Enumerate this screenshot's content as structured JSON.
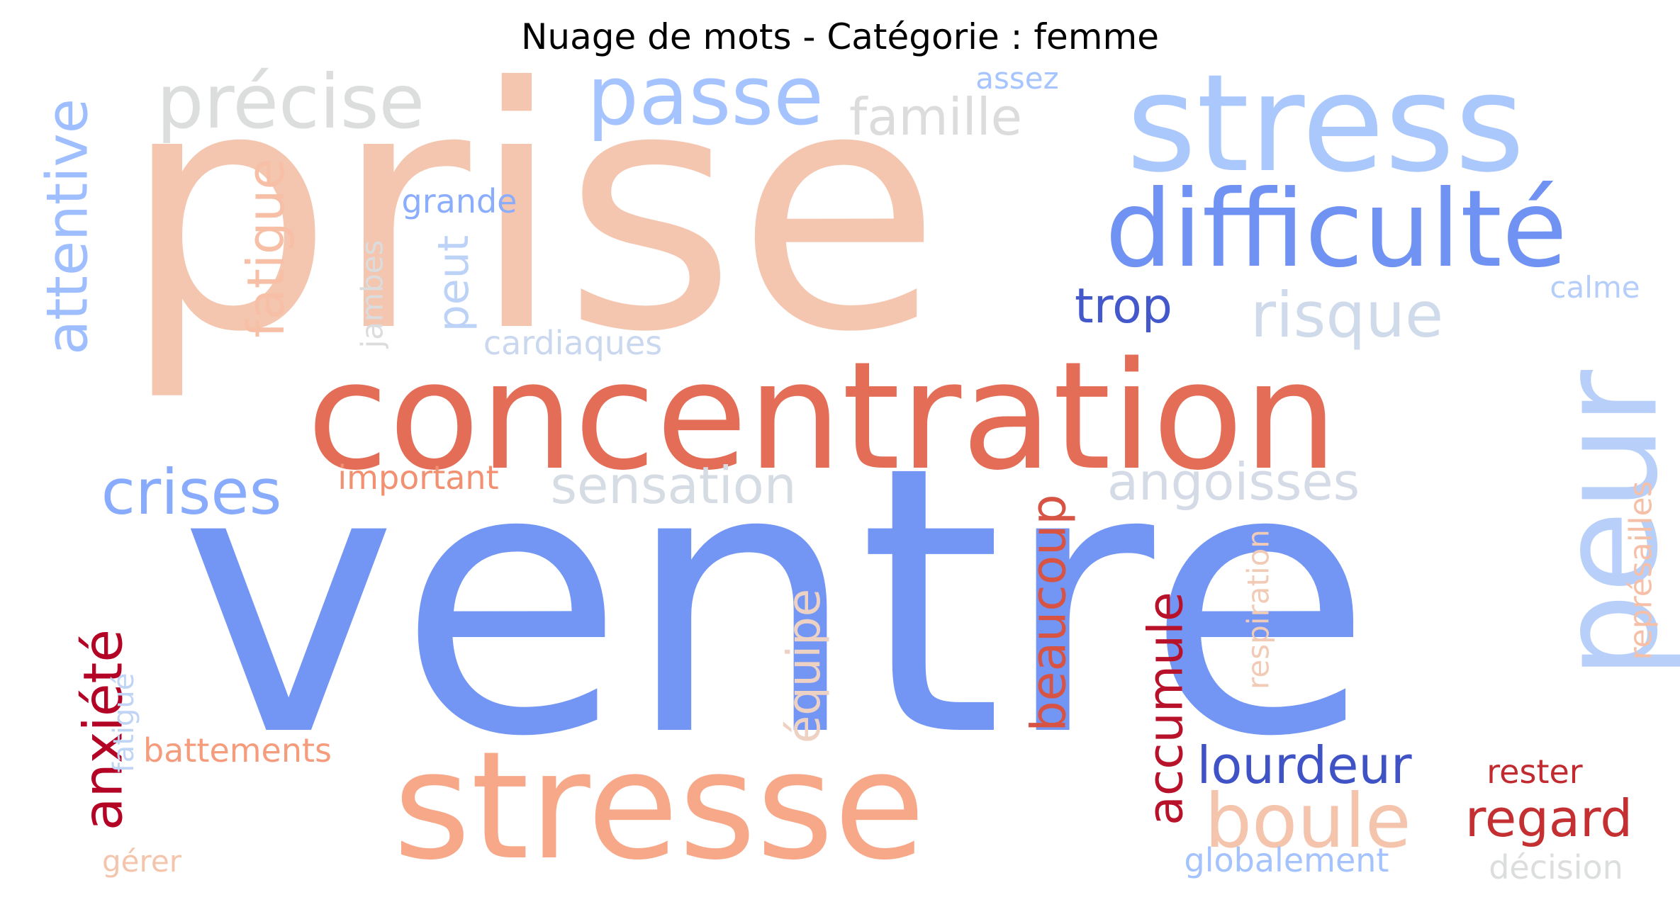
{
  "chart_data": {
    "type": "wordcloud",
    "title": "Nuage de mots - Catégorie : femme",
    "colormap": "coolwarm",
    "background": "#ffffff",
    "words": [
      {
        "text": "ventre",
        "weight": 100,
        "color": "#7396f5",
        "orientation": "horizontal"
      },
      {
        "text": "prise",
        "weight": 88,
        "color": "#f4c6af",
        "orientation": "horizontal"
      },
      {
        "text": "concentration",
        "weight": 44,
        "color": "#e36d56",
        "orientation": "horizontal"
      },
      {
        "text": "stresse",
        "weight": 43,
        "color": "#f7a889",
        "orientation": "horizontal"
      },
      {
        "text": "stress",
        "weight": 40,
        "color": "#abc8fd",
        "orientation": "horizontal"
      },
      {
        "text": "peur",
        "weight": 38,
        "color": "#b8d0f9",
        "orientation": "vertical"
      },
      {
        "text": "difficulté",
        "weight": 30,
        "color": "#6f92f3",
        "orientation": "horizontal"
      },
      {
        "text": "passe",
        "weight": 24,
        "color": "#a5c3fe",
        "orientation": "horizontal"
      },
      {
        "text": "précise",
        "weight": 22,
        "color": "#dcdddd",
        "orientation": "horizontal"
      },
      {
        "text": "boule",
        "weight": 22,
        "color": "#f5c4ac",
        "orientation": "horizontal"
      },
      {
        "text": "crises",
        "weight": 18,
        "color": "#88abfd",
        "orientation": "horizontal"
      },
      {
        "text": "risque",
        "weight": 18,
        "color": "#cfdaea",
        "orientation": "horizontal"
      },
      {
        "text": "attentive",
        "weight": 17,
        "color": "#9ebeff",
        "orientation": "vertical"
      },
      {
        "text": "anxiété",
        "weight": 16,
        "color": "#b40426",
        "orientation": "vertical"
      },
      {
        "text": "famille",
        "weight": 15,
        "color": "#dddcdc",
        "orientation": "horizontal"
      },
      {
        "text": "fatigue",
        "weight": 15,
        "color": "#f6bfa6",
        "orientation": "vertical"
      },
      {
        "text": "sensation",
        "weight": 15,
        "color": "#d6dce4",
        "orientation": "horizontal"
      },
      {
        "text": "angoisses",
        "weight": 15,
        "color": "#d4dbe6",
        "orientation": "horizontal"
      },
      {
        "text": "beaucoup",
        "weight": 15,
        "color": "#d75445",
        "orientation": "vertical"
      },
      {
        "text": "accumule",
        "weight": 15,
        "color": "#b8122a",
        "orientation": "vertical"
      },
      {
        "text": "lourdeur",
        "weight": 15,
        "color": "#3f53c6",
        "orientation": "horizontal"
      },
      {
        "text": "regard",
        "weight": 15,
        "color": "#c43032",
        "orientation": "horizontal"
      },
      {
        "text": "trop",
        "weight": 14,
        "color": "#4358cb",
        "orientation": "horizontal"
      },
      {
        "text": "équipe",
        "weight": 14,
        "color": "#edd1c2",
        "orientation": "vertical"
      },
      {
        "text": "peut",
        "weight": 12,
        "color": "#bcd2f7",
        "orientation": "vertical"
      },
      {
        "text": "grande",
        "weight": 10,
        "color": "#8badfd",
        "orientation": "horizontal"
      },
      {
        "text": "important",
        "weight": 10,
        "color": "#f29072",
        "orientation": "horizontal"
      },
      {
        "text": "battements",
        "weight": 10,
        "color": "#f59c7d",
        "orientation": "horizontal"
      },
      {
        "text": "cardiaques",
        "weight": 10,
        "color": "#cad8ef",
        "orientation": "horizontal"
      },
      {
        "text": "jambes",
        "weight": 9,
        "color": "#dbdcde",
        "orientation": "vertical"
      },
      {
        "text": "assez",
        "weight": 9,
        "color": "#a6c4fe",
        "orientation": "horizontal"
      },
      {
        "text": "calme",
        "weight": 9,
        "color": "#b5cdfa",
        "orientation": "horizontal"
      },
      {
        "text": "respiration",
        "weight": 9,
        "color": "#f2cbb7",
        "orientation": "vertical"
      },
      {
        "text": "représailles",
        "weight": 10,
        "color": "#f5c0a7",
        "orientation": "vertical"
      },
      {
        "text": "fatigué",
        "weight": 9,
        "color": "#c0d4f5",
        "orientation": "vertical"
      },
      {
        "text": "gérer",
        "weight": 9,
        "color": "#f4c5ad",
        "orientation": "horizontal"
      },
      {
        "text": "globalement",
        "weight": 10,
        "color": "#a3c2fe",
        "orientation": "horizontal"
      },
      {
        "text": "rester",
        "weight": 10,
        "color": "#c12b30",
        "orientation": "horizontal"
      },
      {
        "text": "décision",
        "weight": 10,
        "color": "#dcdddd",
        "orientation": "horizontal"
      }
    ]
  }
}
